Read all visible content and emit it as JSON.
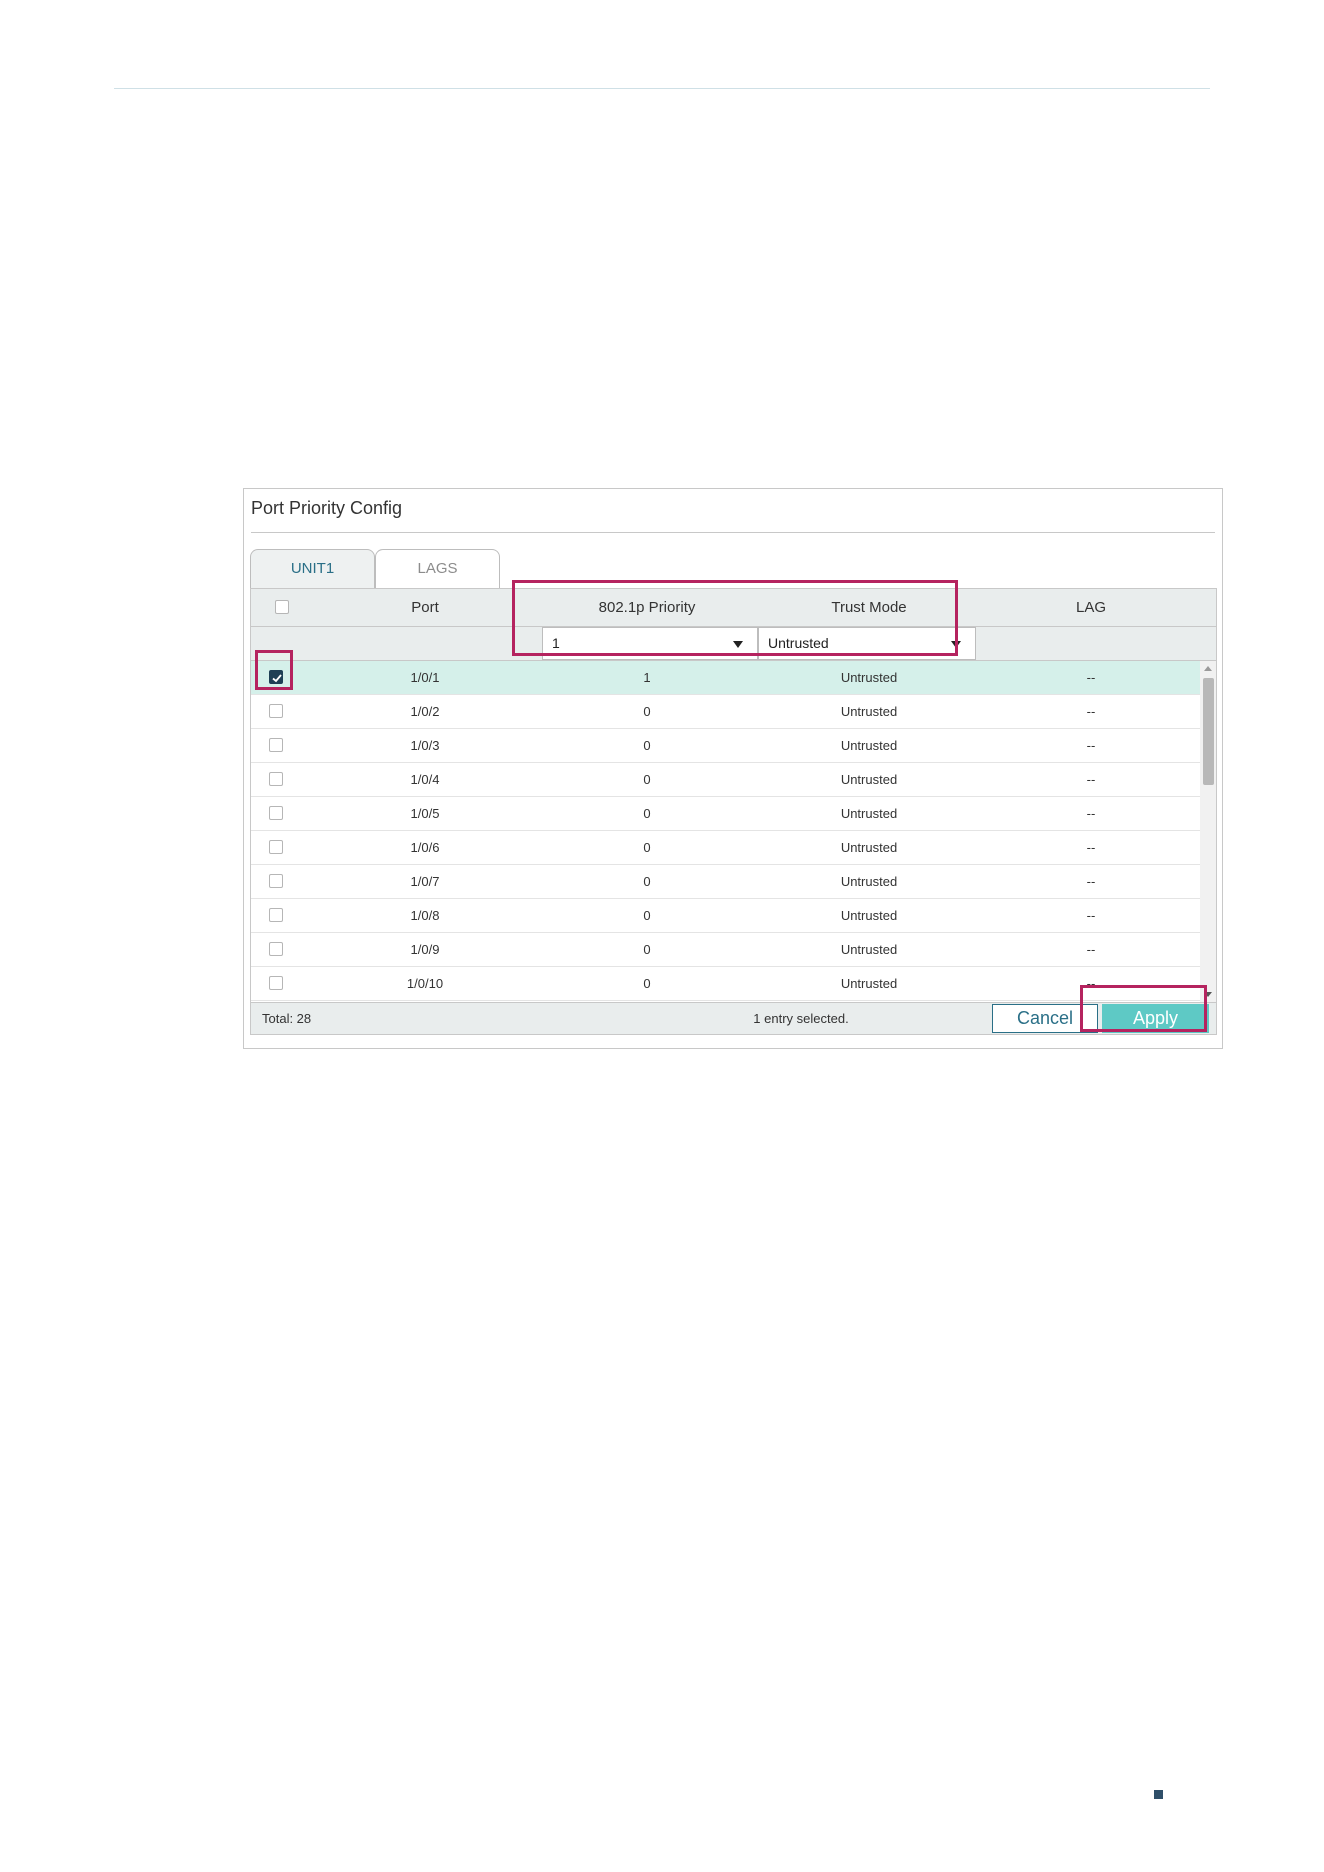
{
  "panel": {
    "title": "Port Priority Config"
  },
  "tabs": [
    {
      "label": "UNIT1",
      "active": true
    },
    {
      "label": "LAGS",
      "active": false
    }
  ],
  "table": {
    "columns": [
      "Port",
      "802.1p Priority",
      "Trust Mode",
      "LAG"
    ],
    "filters": {
      "priority_value": "1",
      "trust_mode_value": "Untrusted"
    },
    "rows": [
      {
        "checked": true,
        "port": "1/0/1",
        "priority": "1",
        "trust": "Untrusted",
        "lag": "--"
      },
      {
        "checked": false,
        "port": "1/0/2",
        "priority": "0",
        "trust": "Untrusted",
        "lag": "--"
      },
      {
        "checked": false,
        "port": "1/0/3",
        "priority": "0",
        "trust": "Untrusted",
        "lag": "--"
      },
      {
        "checked": false,
        "port": "1/0/4",
        "priority": "0",
        "trust": "Untrusted",
        "lag": "--"
      },
      {
        "checked": false,
        "port": "1/0/5",
        "priority": "0",
        "trust": "Untrusted",
        "lag": "--"
      },
      {
        "checked": false,
        "port": "1/0/6",
        "priority": "0",
        "trust": "Untrusted",
        "lag": "--"
      },
      {
        "checked": false,
        "port": "1/0/7",
        "priority": "0",
        "trust": "Untrusted",
        "lag": "--"
      },
      {
        "checked": false,
        "port": "1/0/8",
        "priority": "0",
        "trust": "Untrusted",
        "lag": "--"
      },
      {
        "checked": false,
        "port": "1/0/9",
        "priority": "0",
        "trust": "Untrusted",
        "lag": "--"
      },
      {
        "checked": false,
        "port": "1/0/10",
        "priority": "0",
        "trust": "Untrusted",
        "lag": "--"
      }
    ]
  },
  "footer": {
    "total": "Total: 28",
    "selected": "1 entry selected.",
    "cancel_label": "Cancel",
    "apply_label": "Apply"
  },
  "colors": {
    "accent": "#5ec9c5",
    "selected_row": "#d5f0ea",
    "highlight": "#b5235f",
    "checkbox_checked": "#1f3f55"
  }
}
